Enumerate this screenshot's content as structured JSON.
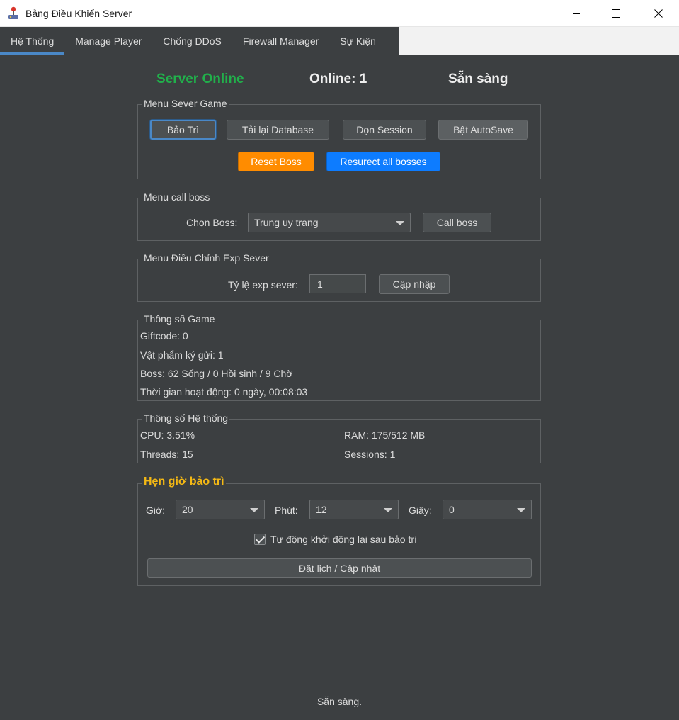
{
  "window": {
    "title": "Bảng Điều Khiển Server",
    "icon": "joystick-icon"
  },
  "tabs": [
    {
      "label": "Hệ Thống",
      "active": true
    },
    {
      "label": "Manage Player"
    },
    {
      "label": "Chống DDoS"
    },
    {
      "label": "Firewall Manager"
    },
    {
      "label": "Sự Kiện"
    }
  ],
  "status": {
    "server": "Server Online",
    "online": "Online: 1",
    "state": "Sẵn sàng"
  },
  "menu_server": {
    "legend": "Menu Sever Game",
    "maintenance": "Bảo Trì",
    "reload_db": "Tải lại Database",
    "clean_session": "Dọn Session",
    "autosave": "Bật AutoSave",
    "reset_boss": "Reset Boss",
    "resurrect": "Resurect all bosses"
  },
  "menu_boss": {
    "legend": "Menu call boss",
    "label": "Chọn Boss:",
    "selected": "Trung uy trang",
    "button": "Call boss"
  },
  "menu_exp": {
    "legend": "Menu Điều Chỉnh Exp Sever",
    "label": "Tỷ lệ exp sever:",
    "value": "1",
    "button": "Cập nhập"
  },
  "game_stats": {
    "legend": "Thông số Game",
    "giftcode": "Giftcode: 0",
    "items": "Vật phẩm ký gửi: 1",
    "boss": "Boss: 62 Sống / 0 Hồi sinh / 9 Chờ",
    "uptime": "Thời gian hoạt động: 0 ngày, 00:08:03"
  },
  "system_stats": {
    "legend": "Thông số Hệ thống",
    "cpu": "CPU: 3.51%",
    "ram": "RAM: 175/512 MB",
    "threads": "Threads: 15",
    "sessions": "Sessions: 1"
  },
  "schedule": {
    "legend": "Hẹn giờ bảo trì",
    "hour_label": "Giờ:",
    "hour": "20",
    "minute_label": "Phút:",
    "minute": "12",
    "second_label": "Giây:",
    "second": "0",
    "auto_restart": "Tự động khởi động lại sau bảo trì",
    "auto_restart_checked": true,
    "submit": "Đặt lịch / Cập nhật"
  },
  "footer": "Sẵn sàng.",
  "colors": {
    "online": "#21b04b",
    "orange": "#ff8c00",
    "blue": "#0d7cff",
    "legend_yellow": "#f5b914",
    "tab_accent": "#4a88c7"
  }
}
